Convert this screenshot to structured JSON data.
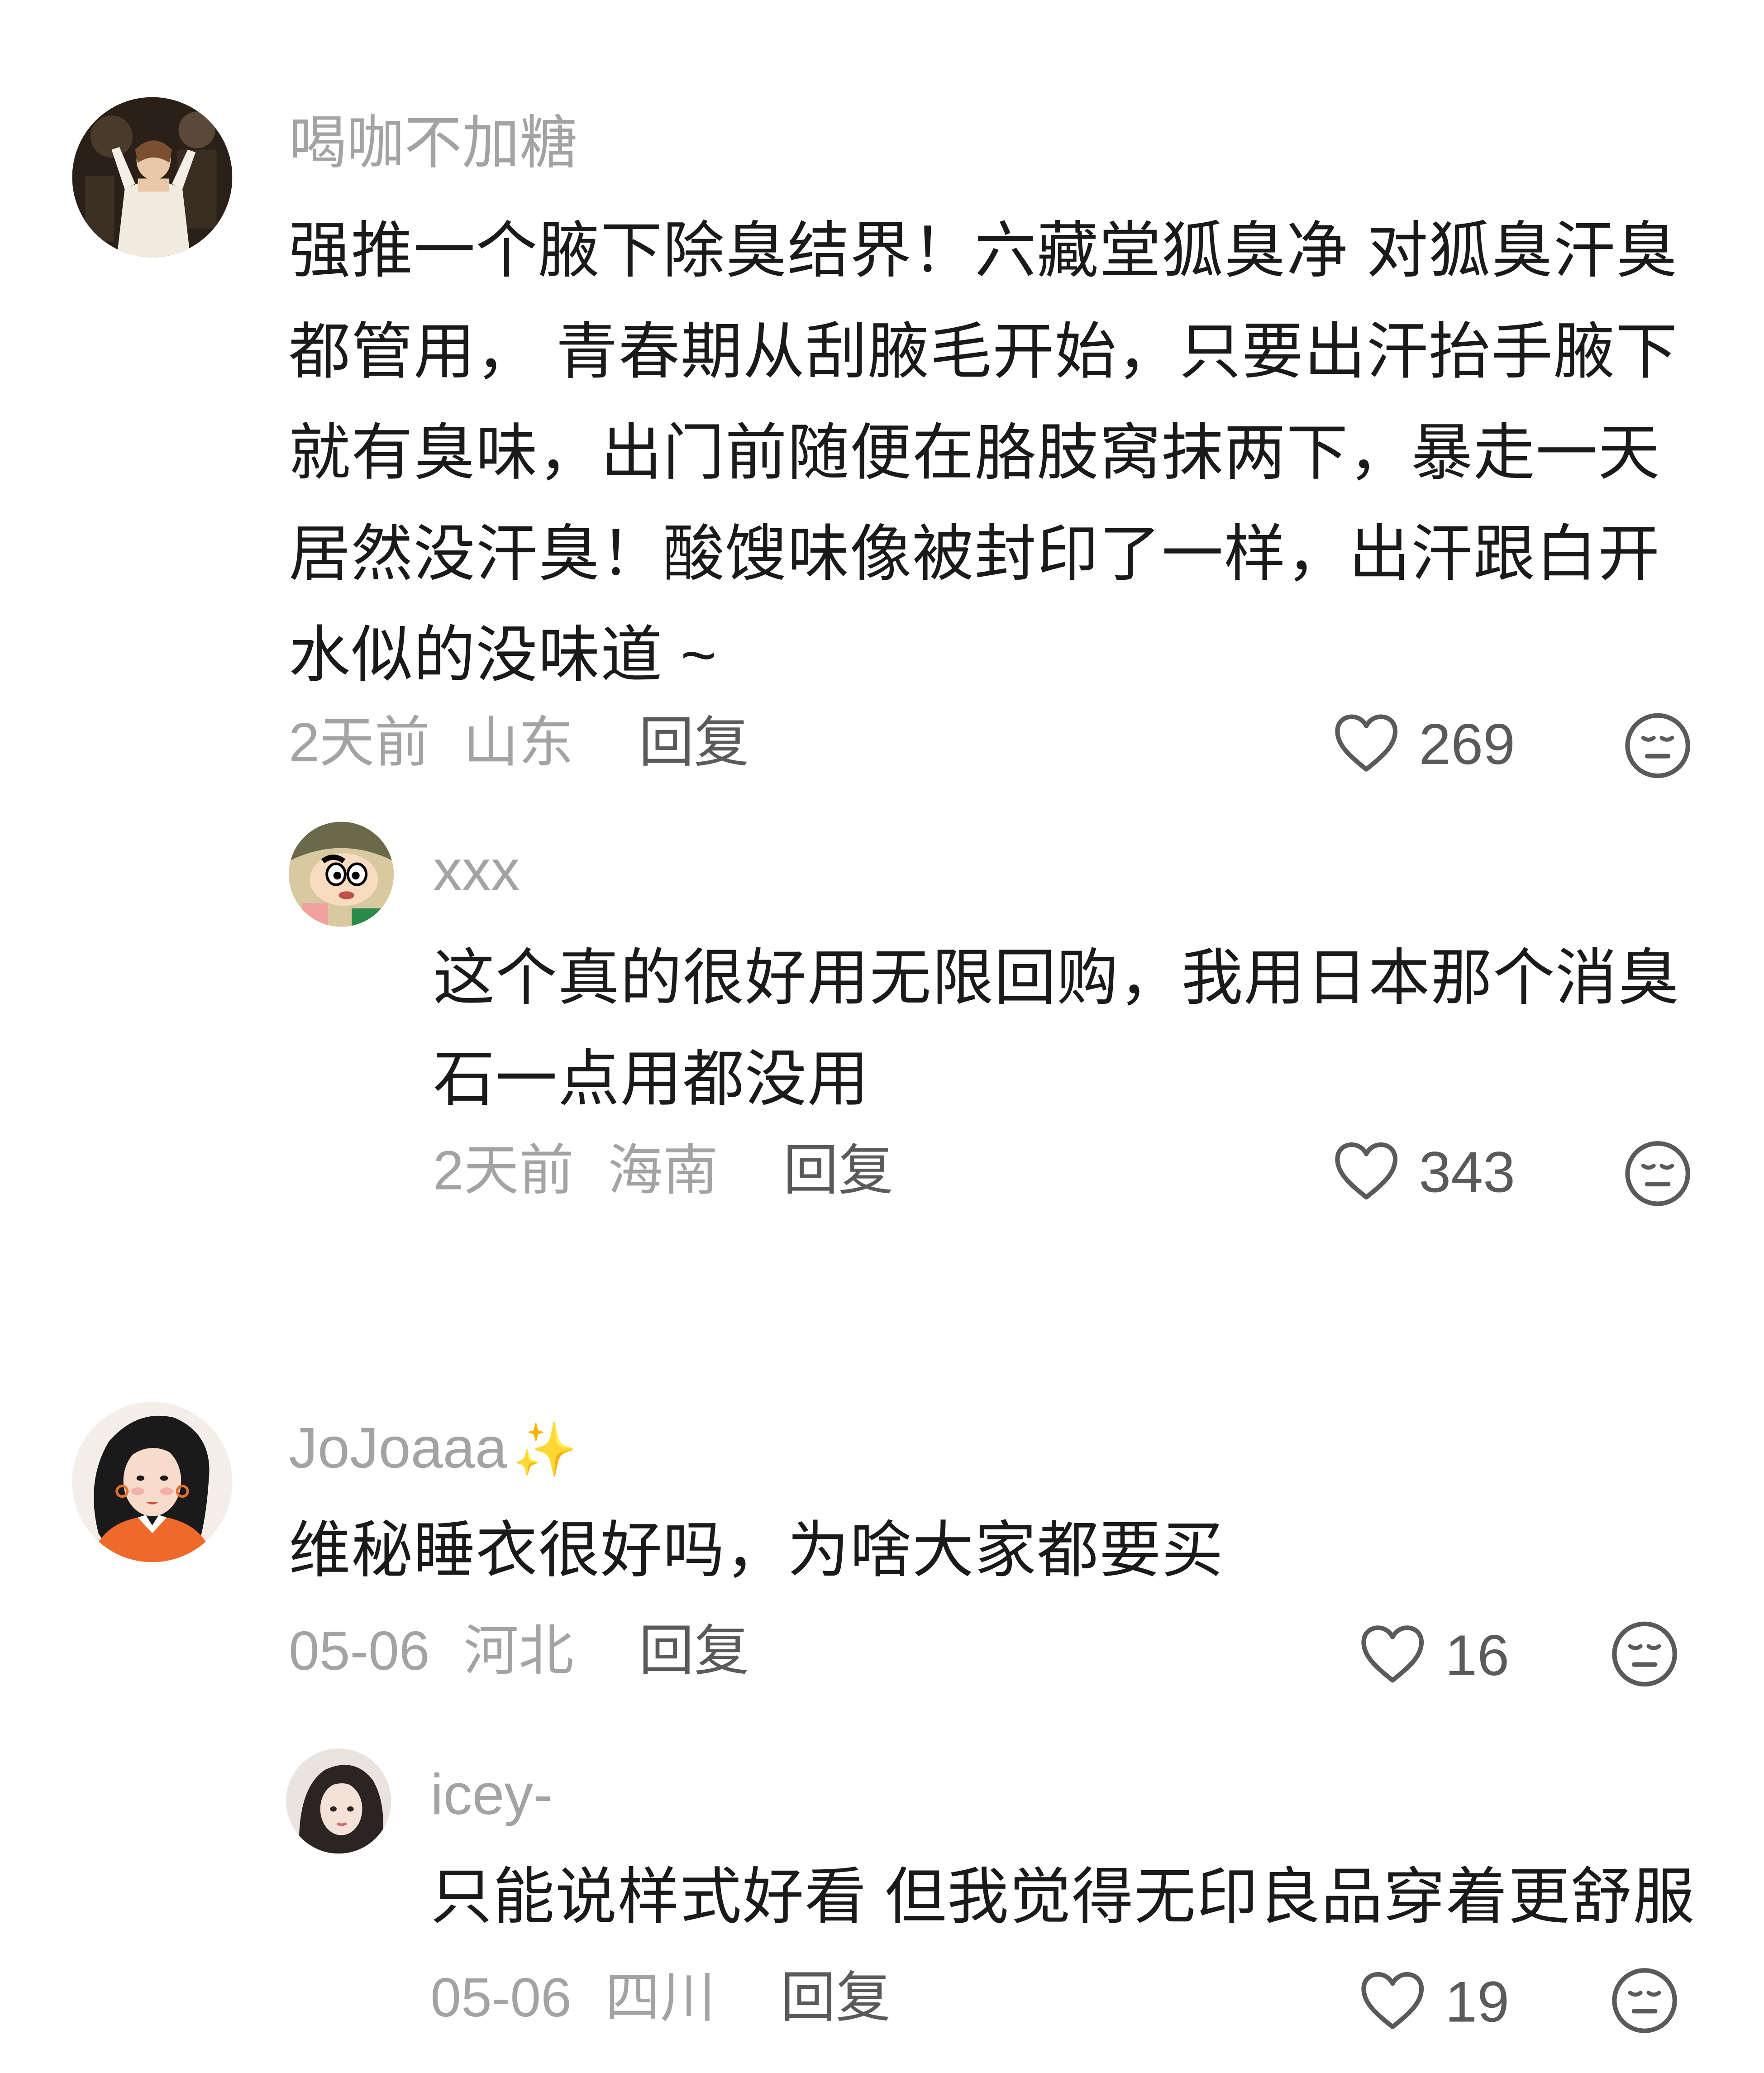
{
  "comments": [
    {
      "username": "喝咖不加糖",
      "content_lines": [
        "强推一个腋下除臭结界！六藏堂狐臭净 对狐臭汗臭",
        "都管用， 青春期从刮腋毛开始，只要出汗抬手腋下",
        "就有臭味，出门前随便在胳肢窝抹两下，暴走一天",
        "居然没汗臭！酸馊味像被封印了一样，出汗跟白开",
        "水似的没味道 ~"
      ],
      "time": "2天前",
      "location": "山东",
      "reply_label": "回复",
      "likes": "269",
      "avatar_icon": "woman-in-dress-avatar",
      "replies": [
        {
          "username": "xxx",
          "content_lines": [
            "这个真的很好用无限回购，我用日本那个消臭",
            "石一点用都没用"
          ],
          "time": "2天前",
          "location": "海南",
          "reply_label": "回复",
          "likes": "343",
          "avatar_icon": "cartoon-boy-avatar"
        }
      ]
    },
    {
      "username": "JoJoaaa",
      "username_suffix": "✨",
      "content_lines": [
        "维秘睡衣很好吗，为啥大家都要买"
      ],
      "time": "05-06",
      "location": "河北",
      "reply_label": "回复",
      "likes": "16",
      "avatar_icon": "illustrated-woman-avatar",
      "replies": [
        {
          "username": "icey-",
          "content_lines": [
            "只能说样式好看 但我觉得无印良品穿着更舒服"
          ],
          "time": "05-06",
          "location": "四川",
          "reply_label": "回复",
          "likes": "19",
          "avatar_icon": "girl-photo-avatar"
        }
      ]
    }
  ],
  "icons": {
    "like": "heart-outline-icon",
    "dislike": "neutral-face-icon"
  },
  "colors": {
    "username": "#a3a3a3",
    "text": "#1a1a1a",
    "meta": "#a3a3a3",
    "action": "#5a5a5a"
  }
}
